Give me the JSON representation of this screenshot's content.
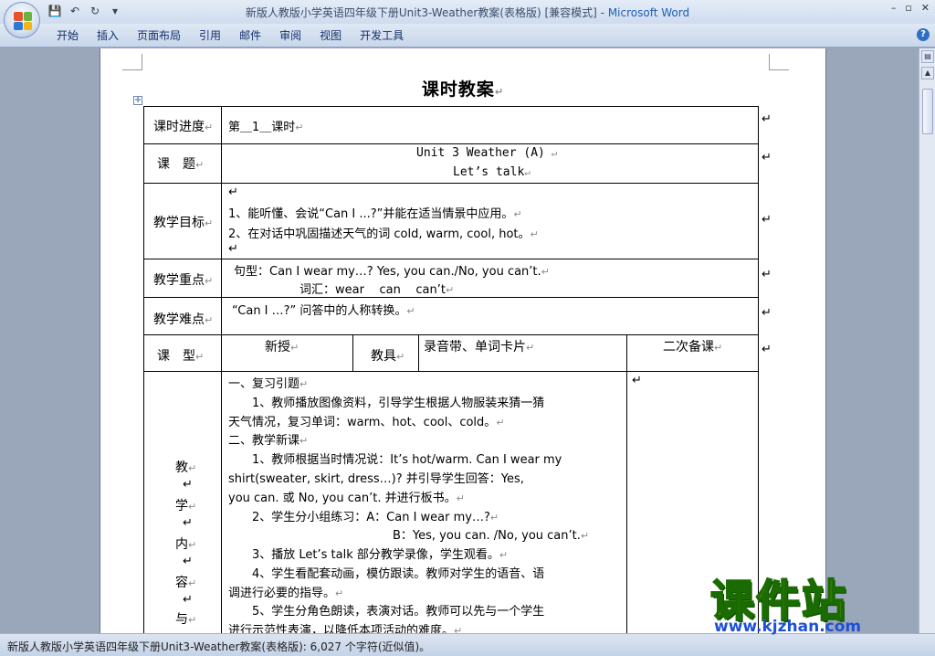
{
  "window": {
    "title": "新版人教版小学英语四年级下册Unit3-Weather教案(表格版) [兼容模式] - ",
    "app_name": "Microsoft Word",
    "controls": [
      "–",
      "▫",
      "✕"
    ]
  },
  "quick_access": {
    "save": "💾",
    "undo": "↶",
    "redo": "↻",
    "more": "▾"
  },
  "ribbon": {
    "tabs": [
      "开始",
      "插入",
      "页面布局",
      "引用",
      "邮件",
      "审阅",
      "视图",
      "开发工具"
    ],
    "help": "?"
  },
  "document": {
    "title": "课时教案",
    "rows": {
      "progress": {
        "label": "课时进度",
        "value": "第＿1＿课时"
      },
      "topic": {
        "label": "课　题",
        "line1": "Unit 3  Weather (A)",
        "line2": "Let’s  talk"
      },
      "goals": {
        "label": "教学目标",
        "items": [
          "1、能听懂、会说“Can I ...?”并能在适当情景中应用。",
          "2、在对话中巩固描述天气的词 cold, warm, cool, hot。"
        ]
      },
      "key_points": {
        "label": "教学重点",
        "line1": "句型：Can I wear my…? Yes, you can./No, you can’t.",
        "line2": "词汇：wear    can    can’t"
      },
      "difficulty": {
        "label": "教学难点",
        "value": "“Can I …?” 问答中的人称转换。"
      },
      "course_type": {
        "label": "课　型",
        "type_value": "新授",
        "tool_label": "教具",
        "tool_value": "录音带、单词卡片",
        "second_prep": "二次备课"
      },
      "content": {
        "label_chars": [
          "教",
          "学",
          "内",
          "容",
          "与"
        ],
        "lines": [
          "一、复习引题",
          "　　1、教师播放图像资料，引导学生根据人物服装来猜一猜",
          "天气情况，复习单词：warm、hot、cool、cold。",
          "二、教学新课",
          "　　1、教师根据当时情况说：It’s hot/warm. Can I wear my",
          "shirt(sweater, skirt, dress…)? 并引导学生回答：Yes,",
          "you can. 或 No, you can’t. 并进行板书。",
          "　　2、学生分小组练习：A：Can I wear my…?",
          "B：Yes, you can. /No, you can’t.",
          "　　3、播放 Let’s talk 部分教学录像，学生观看。",
          "　　4、学生看配套动画，模仿跟读。教师对学生的语音、语",
          "调进行必要的指导。",
          "　　5、学生分角色朗读，表演对话。教师可以先与一个学生",
          "进行示范性表演，以降低本项活动的难度。"
        ]
      }
    }
  },
  "status_bar": {
    "text": "新版人教版小学英语四年级下册Unit3-Weather教案(表格版): 6,027 个字符(近似值)。"
  },
  "watermark": {
    "title": "课件站",
    "url": "www.kjzhan.com"
  },
  "colors": {
    "app_blue": "#1f5fb5",
    "watermark_yellow": "#ffd400",
    "watermark_blue": "#1e4fd6"
  }
}
